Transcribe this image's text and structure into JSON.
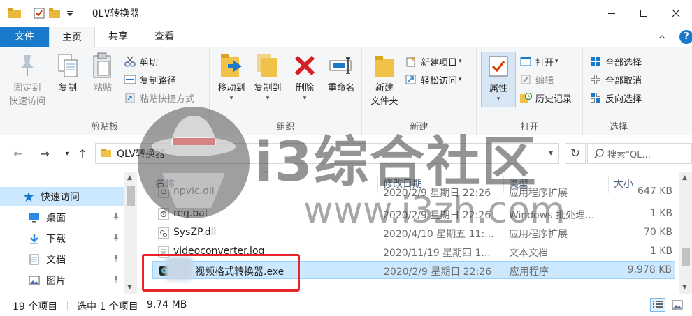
{
  "window": {
    "title": "QLV转换器"
  },
  "ribbon_tabs": [
    {
      "label": "文件"
    },
    {
      "label": "主页"
    },
    {
      "label": "共享"
    },
    {
      "label": "查看"
    }
  ],
  "ribbon": {
    "clipboard": {
      "group_label": "剪贴板",
      "pin_quick_access": [
        "固定到",
        "快速访问"
      ],
      "copy": "复制",
      "paste": "粘贴",
      "cut": "剪切",
      "copy_path": "复制路径",
      "paste_shortcut": "粘贴快捷方式"
    },
    "organize": {
      "group_label": "组织",
      "move_to": "移动到",
      "copy_to": "复制到",
      "delete": "删除",
      "rename": "重命名"
    },
    "new": {
      "group_label": "新建",
      "new_folder": [
        "新建",
        "文件夹"
      ],
      "new_item": "新建项目",
      "easy_access": "轻松访问"
    },
    "open": {
      "group_label": "打开",
      "properties": "属性",
      "open": "打开",
      "edit": "编辑",
      "history": "历史记录"
    },
    "select": {
      "group_label": "选择",
      "select_all": "全部选择",
      "select_none": "全部取消",
      "invert": "反向选择"
    }
  },
  "address": {
    "path": "QLV转换器",
    "search_placeholder": "搜索\"QL..."
  },
  "nav_pane": {
    "items": [
      {
        "label": "快速访问",
        "icon": "star-icon"
      },
      {
        "label": "桌面",
        "icon": "desktop-icon"
      },
      {
        "label": "下载",
        "icon": "download-icon"
      },
      {
        "label": "文档",
        "icon": "document-icon"
      },
      {
        "label": "图片",
        "icon": "picture-icon"
      }
    ]
  },
  "columns": {
    "name": "名称",
    "date": "修改日期",
    "type": "类型",
    "size": "大小"
  },
  "files": [
    {
      "name": "npvic.dll",
      "date": "2020/2/9 星期日 22:26",
      "type": "应用程序扩展",
      "size": "647 KB",
      "icon": "dll-file-icon"
    },
    {
      "name": "reg.bat",
      "date": "2020/2/9 星期日 22:26",
      "type": "Windows 批处理...",
      "size": "1 KB",
      "icon": "bat-file-icon"
    },
    {
      "name": "SysZP.dll",
      "date": "2020/4/10 星期五 11:...",
      "type": "应用程序扩展",
      "size": "70 KB",
      "icon": "dll-file-icon"
    },
    {
      "name": "videoconverter.log",
      "date": "2020/11/19 星期四 1...",
      "type": "文本文档",
      "size": "1 KB",
      "icon": "text-file-icon"
    },
    {
      "name": "视频格式转换器.exe",
      "date": "2020/2/9 星期日 22:26",
      "type": "应用程序",
      "size": "9,978 KB",
      "icon": "app-exe-icon"
    }
  ],
  "status": {
    "count": "19 个项目",
    "selection": "选中 1 个项目",
    "size": "9.74 MB"
  },
  "watermark": {
    "brand": "i3综合社区",
    "url": "www.i3zh.com"
  },
  "colors": {
    "accent": "#1979ca",
    "selection": "#cce8ff",
    "highlight_box": "#e8232a"
  }
}
